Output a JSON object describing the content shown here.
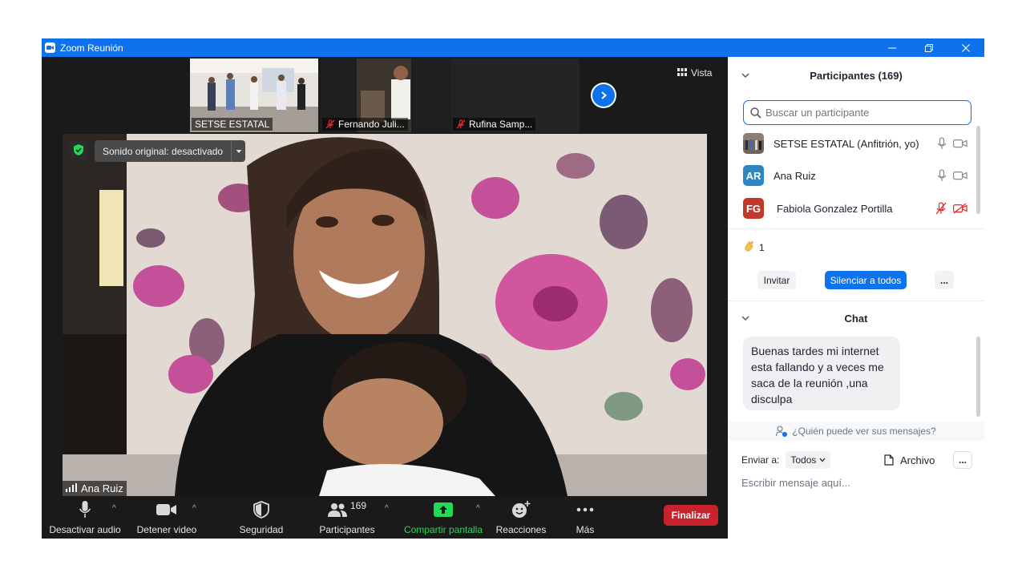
{
  "window": {
    "title": "Zoom Reunión"
  },
  "thumbnails": [
    {
      "name": "SETSE ESTATAL",
      "muted": false
    },
    {
      "name": "Fernando Juli...",
      "muted": true
    },
    {
      "name": "Rufina Samp...",
      "muted": true
    }
  ],
  "view_button": {
    "label": "Vista",
    "icon": "grid-icon"
  },
  "main_video": {
    "audio_pill": "Sonido original: desactivado",
    "speaker_name": "Ana Ruiz"
  },
  "toolbar": {
    "mute_label": "Desactivar audio",
    "video_label": "Detener video",
    "security_label": "Seguridad",
    "participants_label": "Participantes",
    "participants_count": "169",
    "share_label": "Compartir pantalla",
    "reactions_label": "Reacciones",
    "more_label": "Más",
    "end_label": "Finalizar"
  },
  "participants_panel": {
    "title": "Participantes (169)",
    "search_placeholder": "Buscar un participante",
    "list": [
      {
        "initials": "",
        "name": "SETSE ESTATAL (Anfitrión, yo)",
        "mic": "on",
        "video": "on",
        "avatar_type": "photo"
      },
      {
        "initials": "AR",
        "name": "Ana Ruiz",
        "mic": "on",
        "video": "on",
        "avatar_color": "#2e86c1"
      },
      {
        "initials": "FG",
        "name": "Fabiola Gonzalez Portilla",
        "mic": "off",
        "video": "off",
        "avatar_color": "#c0392b"
      }
    ],
    "reaction": {
      "icon": "clap-icon",
      "count": "1"
    },
    "invite_label": "Invitar",
    "mute_all_label": "Silenciar a todos",
    "more_label": "..."
  },
  "chat_panel": {
    "title": "Chat",
    "messages": [
      {
        "text": "Buenas tardes mi internet esta fallando y a veces me saca de la reunión ,una disculpa"
      }
    ],
    "who_can_see": "¿Quién puede ver sus mensajes?",
    "send_to_label": "Enviar a:",
    "send_to_value": "Todos",
    "file_label": "Archivo",
    "more_label": "...",
    "input_placeholder": "Escribir mensaje aquí..."
  },
  "colors": {
    "accent": "#0e72ed",
    "end_red": "#c8232c",
    "share_green": "#23d959",
    "muted_red": "#e02828"
  }
}
